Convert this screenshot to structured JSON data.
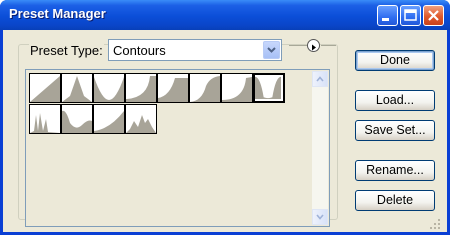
{
  "window": {
    "title": "Preset Manager"
  },
  "titlebar_buttons": [
    "minimize-icon",
    "maximize-icon",
    "close-icon"
  ],
  "preset_type": {
    "label": "Preset Type:",
    "selected": "Contours"
  },
  "contours": [
    "linear",
    "cone",
    "cove-deep",
    "half-round",
    "ring",
    "gaussian",
    "rounded-steps",
    "sawtooth",
    "ring-double",
    "rolling-slope",
    "cove-shallow",
    "ring-triple"
  ],
  "buttons": {
    "done": "Done",
    "load": "Load...",
    "save_set": "Save Set...",
    "rename": "Rename...",
    "delete": "Delete"
  },
  "colors": {
    "contour_fill": "#a8a498",
    "accent": "#0a3fd4"
  }
}
